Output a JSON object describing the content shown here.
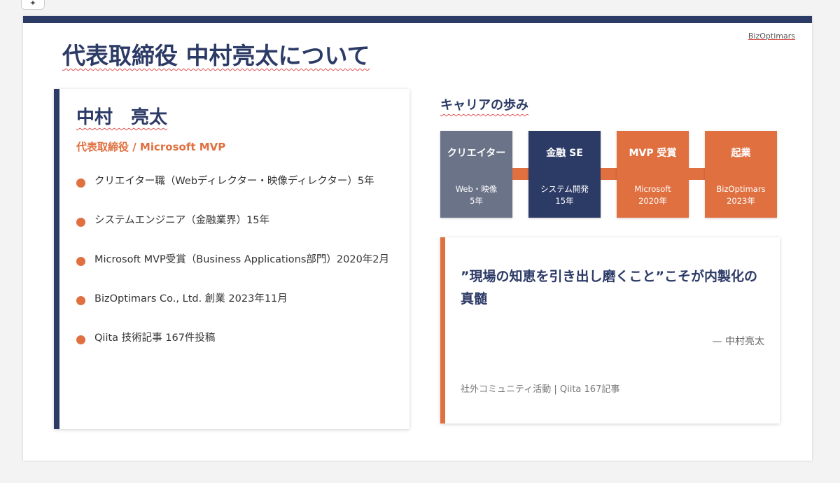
{
  "brand": "BizOptimars",
  "page_title": "代表取締役 中村亮太について",
  "profile": {
    "name": "中村　亮太",
    "role": "代表取締役 / Microsoft MVP",
    "bullets": [
      "クリエイター職（Webディレクター・映像ディレクター）5年",
      "システムエンジニア（金融業界）15年",
      "Microsoft MVP受賞（Business Applications部門）2020年2月",
      "BizOptimars Co., Ltd. 創業 2023年11月",
      "Qiita 技術記事 167件投稿"
    ]
  },
  "career": {
    "title": "キャリアの歩み",
    "steps": [
      {
        "title": "クリエイター",
        "sub1": "Web・映像",
        "sub2": "5年",
        "color": "#6b7388"
      },
      {
        "title": "金融 SE",
        "sub1": "システム開発",
        "sub2": "15年",
        "color": "#2c3a66"
      },
      {
        "title": "MVP 受賞",
        "sub1": "Microsoft",
        "sub2": "2020年",
        "color": "#e07040"
      },
      {
        "title": "起業",
        "sub1": "BizOptimars",
        "sub2": "2023年",
        "color": "#e07040"
      }
    ]
  },
  "quote": {
    "text": "”現場の知恵を引き出し磨くこと”こそが内製化の真髄",
    "author": "— 中村亮太",
    "footer": "社外コミュニティ活動 | Qiita 167記事"
  },
  "colors": {
    "navy": "#2c3a66",
    "orange": "#e07040",
    "gray": "#6b7388"
  },
  "icons": {
    "corner_tool": "magic-wand-icon"
  }
}
